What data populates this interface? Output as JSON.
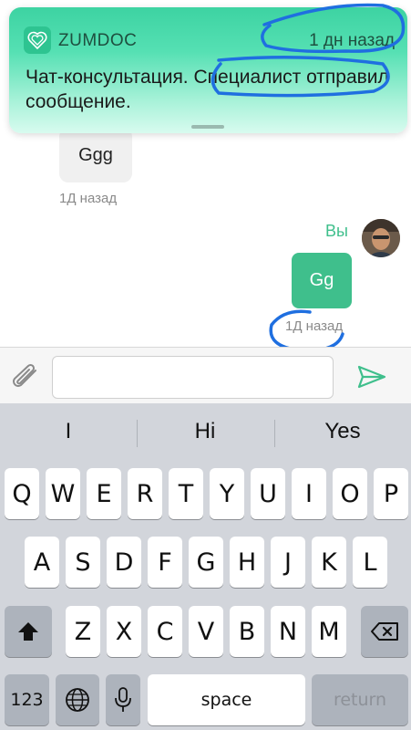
{
  "notification": {
    "app_name": "ZUMDOC",
    "time": "1 дн назад",
    "body": "Чат-консультация. Специалист отправил сообщение.",
    "icon": "heart-fingerprint-icon"
  },
  "chat": {
    "incoming": {
      "text": "Ggg",
      "time": "1Д назад"
    },
    "outgoing": {
      "author": "Вы",
      "text": "Gg",
      "time": "1Д назад"
    }
  },
  "composer": {
    "value": "",
    "placeholder": "",
    "attach_icon": "paperclip-icon",
    "send_icon": "send-icon"
  },
  "keyboard": {
    "suggestions": [
      "I",
      "Hi",
      "Yes"
    ],
    "row1": [
      "Q",
      "W",
      "E",
      "R",
      "T",
      "Y",
      "U",
      "I",
      "O",
      "P"
    ],
    "row2": [
      "A",
      "S",
      "D",
      "F",
      "G",
      "H",
      "J",
      "K",
      "L"
    ],
    "row3": [
      "Z",
      "X",
      "C",
      "V",
      "B",
      "N",
      "M"
    ],
    "numbers_label": "123",
    "space_label": "space",
    "return_label": "return"
  },
  "colors": {
    "accent": "#3fbf8c",
    "notification_top": "#3dd3a2",
    "keyboard_bg": "#d2d5db",
    "annotation": "#1f6fe0"
  }
}
